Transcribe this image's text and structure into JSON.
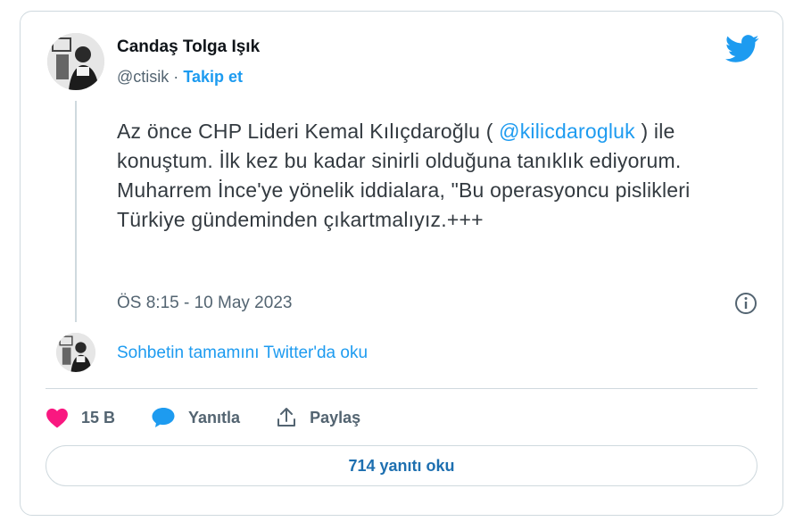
{
  "author": {
    "name": "Candaş Tolga Işık",
    "handle": "@ctisik",
    "separator": "·",
    "follow_label": "Takip et"
  },
  "tweet": {
    "text_before": "Az önce CHP Lideri Kemal Kılıçdaroğlu ( ",
    "mention": "@kilicdarogluk",
    "text_after": " ) ile konuştum. İlk kez bu kadar sinirli olduğuna tanıklık ediyorum. Muharrem İnce'ye yönelik iddialara, \"Bu operasyoncu pislikleri Türkiye gündeminden çıkartmalıyız.+++",
    "timestamp": "ÖS 8:15 - 10 May 2023"
  },
  "conversation": {
    "link_label": "Sohbetin tamamını Twitter'da oku"
  },
  "actions": {
    "like_count": "15 B",
    "reply_label": "Yanıtla",
    "share_label": "Paylaş"
  },
  "replies_button": {
    "label": "714 yanıtı oku"
  },
  "icons": {
    "brand": "twitter-bird-icon",
    "info": "info-icon",
    "like": "heart-icon",
    "reply": "speech-bubble-icon",
    "share": "share-icon"
  },
  "colors": {
    "accent": "#1d9bf0",
    "like": "#f91880",
    "text": "#0f1419",
    "muted": "#536471",
    "border": "#cfd9de"
  }
}
